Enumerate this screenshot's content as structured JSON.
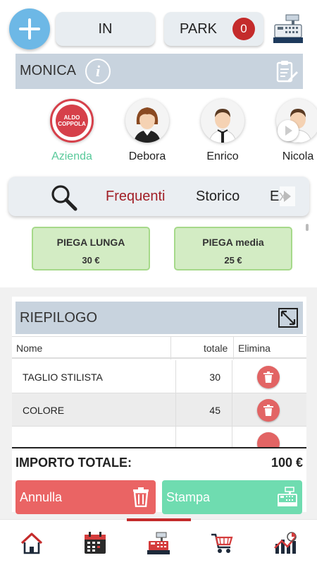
{
  "topbar": {
    "in_label": "IN",
    "park_label": "PARK",
    "park_count": "0"
  },
  "client": {
    "name": "MONICA"
  },
  "staff": {
    "logo_text_line1": "ALDO",
    "logo_text_line2": "COPPOLA",
    "items": [
      {
        "name": "Azienda",
        "active": true
      },
      {
        "name": "Debora"
      },
      {
        "name": "Enrico"
      },
      {
        "name": "Nicola"
      }
    ]
  },
  "tabs": {
    "items": [
      "Frequenti",
      "Storico",
      "Ex"
    ],
    "active": "Frequenti"
  },
  "services": [
    {
      "name": "PIEGA LUNGA",
      "price": "30 €"
    },
    {
      "name": "PIEGA media",
      "price": "25 €"
    }
  ],
  "summary": {
    "title": "RIEPILOGO",
    "columns": {
      "name": "Nome",
      "total": "totale",
      "delete": "Elimina"
    },
    "rows": [
      {
        "name": "TAGLIO STILISTA",
        "total": "30"
      },
      {
        "name": "COLORE",
        "total": "45"
      },
      {
        "name": "",
        "total": ""
      }
    ],
    "total_label": "IMPORTO TOTALE:",
    "total_value": "100 €",
    "cancel_label": "Annulla",
    "print_label": "Stampa"
  },
  "colors": {
    "accent_red": "#c42b2b",
    "plus_blue": "#6db8e6",
    "active_green": "#58c99a",
    "service_green": "#d3ecc4",
    "cancel_red": "#ea6464",
    "print_green": "#6fdcb0"
  },
  "icons": [
    "plus-icon",
    "cash-register-icon",
    "info-icon",
    "clipboard-icon",
    "search-icon",
    "expand-icon",
    "trash-icon",
    "home-icon",
    "calendar-icon",
    "cart-icon",
    "stats-icon"
  ]
}
